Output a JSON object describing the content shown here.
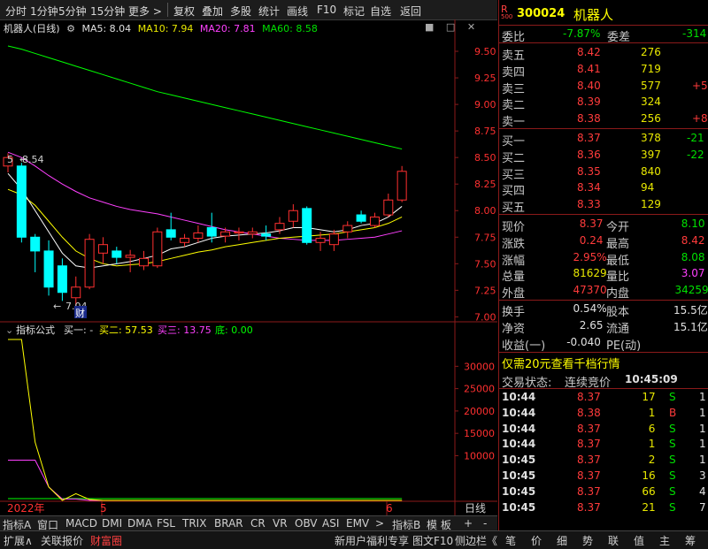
{
  "toolbar": {
    "items": [
      "分时",
      "1分钟",
      "5分钟",
      "15分钟",
      "更多 >",
      "复权",
      "叠加",
      "多股",
      "统计",
      "画线",
      "F10",
      "标记",
      "自选",
      "返回"
    ],
    "window_icons": [
      "■",
      "□",
      "✕"
    ]
  },
  "chart": {
    "title": "机器人(日线)",
    "ma5_label": "MA5: 8.04",
    "ma10_label": "MA10: 7.94",
    "ma20_label": "MA20: 7.81",
    "ma60_label": "MA60: 8.58",
    "high_label": "8.54",
    "low_label": "7.04",
    "event_label": "财",
    "colors": {
      "ma5": "#ffffff",
      "ma10": "#ffff00",
      "ma20": "#ff40ff",
      "ma60": "#00ff00",
      "up": "#ff3030",
      "down": "#00ffff",
      "grid": "#8b1a1a"
    }
  },
  "indicator": {
    "title": "指标公式",
    "buy1": "买一: -",
    "buy2": "买二: 57.53",
    "buy3": "买三: 13.75",
    "bottom": "底: 0.00",
    "y_ticks": [
      "30000",
      "25000",
      "20000",
      "15000",
      "10000"
    ]
  },
  "x_axis": {
    "labels": [
      "2022年",
      "5",
      "6",
      "日线"
    ]
  },
  "chart_data": {
    "type": "candlestick",
    "y_ticks": [
      "9.50",
      "9.25",
      "9.00",
      "8.75",
      "8.50",
      "8.25",
      "8.00",
      "7.75",
      "7.50",
      "7.25",
      "7.00"
    ],
    "ylim": [
      6.97,
      9.65
    ],
    "candles": [
      {
        "o": 8.42,
        "h": 8.54,
        "l": 8.36,
        "c": 8.5
      },
      {
        "o": 8.42,
        "h": 8.45,
        "l": 7.7,
        "c": 7.75
      },
      {
        "o": 7.75,
        "h": 7.78,
        "l": 7.42,
        "c": 7.62
      },
      {
        "o": 7.62,
        "h": 7.72,
        "l": 7.2,
        "c": 7.28
      },
      {
        "o": 7.48,
        "h": 7.55,
        "l": 7.15,
        "c": 7.23
      },
      {
        "o": 7.18,
        "h": 7.38,
        "l": 7.04,
        "c": 7.28
      },
      {
        "o": 7.28,
        "h": 7.78,
        "l": 7.26,
        "c": 7.73
      },
      {
        "o": 7.6,
        "h": 7.75,
        "l": 7.5,
        "c": 7.68
      },
      {
        "o": 7.62,
        "h": 7.66,
        "l": 7.5,
        "c": 7.56
      },
      {
        "o": 7.56,
        "h": 7.63,
        "l": 7.42,
        "c": 7.58
      },
      {
        "o": 7.48,
        "h": 7.62,
        "l": 7.44,
        "c": 7.55
      },
      {
        "o": 7.48,
        "h": 7.84,
        "l": 7.46,
        "c": 7.8
      },
      {
        "o": 7.82,
        "h": 7.98,
        "l": 7.72,
        "c": 7.75
      },
      {
        "o": 7.7,
        "h": 7.78,
        "l": 7.66,
        "c": 7.74
      },
      {
        "o": 7.74,
        "h": 7.86,
        "l": 7.7,
        "c": 7.79
      },
      {
        "o": 7.84,
        "h": 7.98,
        "l": 7.7,
        "c": 7.76
      },
      {
        "o": 7.76,
        "h": 7.84,
        "l": 7.7,
        "c": 7.8
      },
      {
        "o": 7.79,
        "h": 7.84,
        "l": 7.72,
        "c": 7.8
      },
      {
        "o": 7.78,
        "h": 7.84,
        "l": 7.74,
        "c": 7.8
      },
      {
        "o": 7.78,
        "h": 7.86,
        "l": 7.72,
        "c": 7.76
      },
      {
        "o": 7.82,
        "h": 7.94,
        "l": 7.78,
        "c": 7.88
      },
      {
        "o": 7.9,
        "h": 8.06,
        "l": 7.84,
        "c": 8.0
      },
      {
        "o": 8.02,
        "h": 8.04,
        "l": 7.68,
        "c": 7.7
      },
      {
        "o": 7.7,
        "h": 7.8,
        "l": 7.62,
        "c": 7.74
      },
      {
        "o": 7.68,
        "h": 7.82,
        "l": 7.62,
        "c": 7.78
      },
      {
        "o": 7.8,
        "h": 7.9,
        "l": 7.74,
        "c": 7.86
      },
      {
        "o": 7.96,
        "h": 8.0,
        "l": 7.88,
        "c": 7.9
      },
      {
        "o": 7.86,
        "h": 7.98,
        "l": 7.84,
        "c": 7.94
      },
      {
        "o": 7.96,
        "h": 8.16,
        "l": 7.94,
        "c": 8.1
      },
      {
        "o": 8.1,
        "h": 8.42,
        "l": 8.08,
        "c": 8.37
      }
    ],
    "ma5": [
      8.35,
      8.2,
      8.0,
      7.8,
      7.6,
      7.48,
      7.46,
      7.48,
      7.5,
      7.52,
      7.55,
      7.58,
      7.64,
      7.66,
      7.7,
      7.74,
      7.76,
      7.77,
      7.78,
      7.79,
      7.81,
      7.84,
      7.84,
      7.82,
      7.8,
      7.82,
      7.86,
      7.88,
      7.94,
      8.04
    ],
    "ma10": [
      8.2,
      8.15,
      8.05,
      7.9,
      7.75,
      7.62,
      7.55,
      7.5,
      7.48,
      7.49,
      7.5,
      7.52,
      7.55,
      7.58,
      7.61,
      7.63,
      7.66,
      7.68,
      7.7,
      7.72,
      7.74,
      7.75,
      7.76,
      7.77,
      7.78,
      7.8,
      7.82,
      7.84,
      7.88,
      7.94
    ],
    "ma20": [
      8.55,
      8.5,
      8.42,
      8.33,
      8.25,
      8.18,
      8.12,
      8.08,
      8.04,
      8.01,
      7.99,
      7.97,
      7.94,
      7.91,
      7.88,
      7.85,
      7.82,
      7.8,
      7.78,
      7.76,
      7.74,
      7.73,
      7.72,
      7.72,
      7.72,
      7.73,
      7.74,
      7.75,
      7.78,
      7.81
    ],
    "ma60": [
      9.55,
      9.52,
      9.48,
      9.44,
      9.4,
      9.36,
      9.32,
      9.28,
      9.24,
      9.2,
      9.16,
      9.12,
      9.09,
      9.06,
      9.03,
      9.0,
      8.97,
      8.94,
      8.91,
      8.88,
      8.85,
      8.82,
      8.79,
      8.76,
      8.73,
      8.7,
      8.67,
      8.64,
      8.61,
      8.58
    ],
    "indicator_ylim": [
      0,
      36000
    ],
    "indicator_yellow": [
      36000,
      36000,
      13000,
      3000,
      0,
      1500,
      200,
      0,
      0,
      0,
      0,
      0,
      0,
      0,
      0,
      0,
      0,
      0,
      0,
      0,
      0,
      0,
      0,
      0,
      0,
      0,
      0,
      0,
      0,
      0
    ],
    "indicator_magenta": [
      9000,
      9000,
      9000,
      3000,
      300,
      300,
      0,
      0,
      0,
      0,
      0,
      0,
      0,
      0,
      0,
      0,
      0,
      0,
      0,
      0,
      0,
      0,
      0,
      0,
      0,
      0,
      0,
      0,
      0,
      0
    ],
    "indicator_green": [
      400,
      400,
      400,
      400,
      400,
      400,
      400,
      400,
      400,
      400,
      400,
      400,
      400,
      400,
      400,
      400,
      400,
      400,
      400,
      400,
      400,
      400,
      400,
      400,
      400,
      400,
      400,
      400,
      400,
      400
    ]
  },
  "quote": {
    "code": "300024",
    "name": "机器人",
    "r_badge": "R",
    "small_num": "500",
    "weibi_label": "委比",
    "weibi": "-7.87%",
    "weicha_label": "委差",
    "weicha": "-314",
    "asks": [
      {
        "label": "卖五",
        "price": "8.42",
        "vol": "276",
        "chg": ""
      },
      {
        "label": "卖四",
        "price": "8.41",
        "vol": "719",
        "chg": ""
      },
      {
        "label": "卖三",
        "price": "8.40",
        "vol": "577",
        "chg": "+5"
      },
      {
        "label": "卖二",
        "price": "8.39",
        "vol": "324",
        "chg": ""
      },
      {
        "label": "卖一",
        "price": "8.38",
        "vol": "256",
        "chg": "+8"
      }
    ],
    "bids": [
      {
        "label": "买一",
        "price": "8.37",
        "vol": "378",
        "chg": "-21"
      },
      {
        "label": "买二",
        "price": "8.36",
        "vol": "397",
        "chg": "-22"
      },
      {
        "label": "买三",
        "price": "8.35",
        "vol": "840",
        "chg": ""
      },
      {
        "label": "买四",
        "price": "8.34",
        "vol": "94",
        "chg": ""
      },
      {
        "label": "买五",
        "price": "8.33",
        "vol": "129",
        "chg": ""
      }
    ],
    "stats": [
      {
        "l1": "现价",
        "v1": "8.37",
        "l2": "今开",
        "v2": "8.10",
        "c1": "red",
        "c2": "green"
      },
      {
        "l1": "涨跌",
        "v1": "0.24",
        "l2": "最高",
        "v2": "8.42",
        "c1": "red",
        "c2": "red"
      },
      {
        "l1": "涨幅",
        "v1": "2.95%",
        "l2": "最低",
        "v2": "8.08",
        "c1": "red",
        "c2": "green"
      },
      {
        "l1": "总量",
        "v1": "81629",
        "l2": "量比",
        "v2": "3.07",
        "c1": "yellow",
        "c2": "magenta"
      },
      {
        "l1": "外盘",
        "v1": "47370",
        "l2": "内盘",
        "v2": "34259",
        "c1": "red",
        "c2": "green"
      }
    ],
    "stats2": [
      {
        "l1": "换手",
        "v1": "0.54%",
        "l2": "股本",
        "v2": "15.5亿"
      },
      {
        "l1": "净资",
        "v1": "2.65",
        "l2": "流通",
        "v2": "15.1亿"
      },
      {
        "l1": "收益(一)",
        "v1": "-0.040",
        "l2": "PE(动)",
        "v2": ""
      }
    ],
    "promo": "仅需20元查看千档行情",
    "trade_status_label": "交易状态:",
    "trade_status": "连续竞价",
    "trade_time": "10:45:09",
    "ticks": [
      {
        "t": "10:44",
        "p": "8.37",
        "v": "17",
        "d": "S",
        "n": "1"
      },
      {
        "t": "10:44",
        "p": "8.38",
        "v": "1",
        "d": "B",
        "n": "1"
      },
      {
        "t": "10:44",
        "p": "8.37",
        "v": "6",
        "d": "S",
        "n": "1"
      },
      {
        "t": "10:44",
        "p": "8.37",
        "v": "1",
        "d": "S",
        "n": "1"
      },
      {
        "t": "10:45",
        "p": "8.37",
        "v": "2",
        "d": "S",
        "n": "1"
      },
      {
        "t": "10:45",
        "p": "8.37",
        "v": "16",
        "d": "S",
        "n": "3"
      },
      {
        "t": "10:45",
        "p": "8.37",
        "v": "66",
        "d": "S",
        "n": "4"
      },
      {
        "t": "10:45",
        "p": "8.37",
        "v": "21",
        "d": "S",
        "n": "7"
      }
    ]
  },
  "bottom_tabs": [
    "指标A",
    "窗口",
    "MACD",
    "DMI",
    "DMA",
    "FSL",
    "TRIX",
    "BRAR",
    "CR",
    "VR",
    "OBV",
    "ASI",
    "EMV",
    ">",
    "指标B",
    "模 板",
    "+",
    "-"
  ],
  "status_bar": {
    "left": [
      "扩展∧",
      "关联报价",
      "财富圈"
    ],
    "right": [
      "新用户福利专享",
      "图文F10",
      "侧边栏《"
    ],
    "panel_tabs": [
      "笔",
      "价",
      "细",
      "势",
      "联",
      "值",
      "主",
      "筹"
    ]
  }
}
